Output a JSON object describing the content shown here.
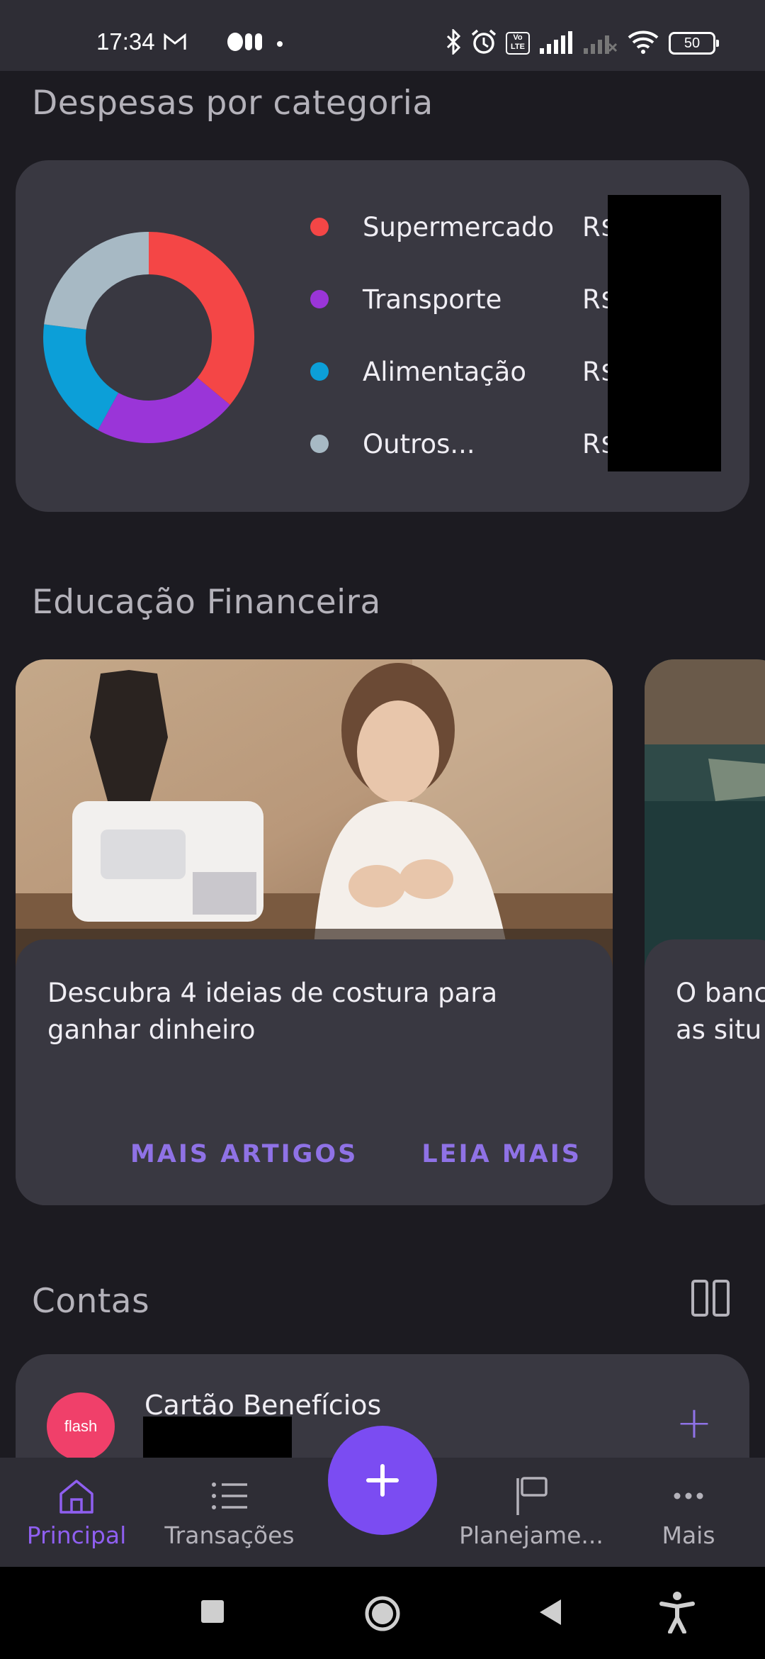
{
  "status_bar": {
    "time": "17:34",
    "battery": "50",
    "volte": "Vo LTE"
  },
  "expenses": {
    "title": "Despesas por categoria",
    "categories": [
      {
        "label": "Supermercado",
        "amount": "R$",
        "color": "#f44646"
      },
      {
        "label": "Transporte",
        "amount": "R$",
        "color": "#9a35d8"
      },
      {
        "label": "Alimentação",
        "amount": "R$",
        "color": "#0c9fd8"
      },
      {
        "label": "Outros...",
        "amount": "R$",
        "color": "#a7b9c4"
      }
    ],
    "donut_fractions": [
      0.36,
      0.22,
      0.19,
      0.23
    ]
  },
  "education": {
    "title": "Educação Financeira",
    "cards": [
      {
        "text": "Descubra 4 ideias de costura para ganhar dinheiro",
        "more_articles": "MAIS ARTIGOS",
        "read_more": "LEIA MAIS"
      },
      {
        "text": "O banc as situ"
      }
    ]
  },
  "accounts": {
    "title": "Contas",
    "items": [
      {
        "logo": "flash",
        "name": "Cartão Benefícios",
        "add": "+"
      }
    ]
  },
  "fab": {
    "label": "+"
  },
  "bottom_nav": {
    "items": [
      {
        "label": "Principal",
        "icon": "home-icon",
        "active": true
      },
      {
        "label": "Transações",
        "icon": "list-icon",
        "active": false
      },
      {
        "label": "Planejame...",
        "icon": "flag-icon",
        "active": false
      },
      {
        "label": "Mais",
        "icon": "more-icon",
        "active": false
      }
    ]
  },
  "colors": {
    "accent": "#7b4cf2",
    "card": "#393841",
    "background": "#1c1b21"
  }
}
